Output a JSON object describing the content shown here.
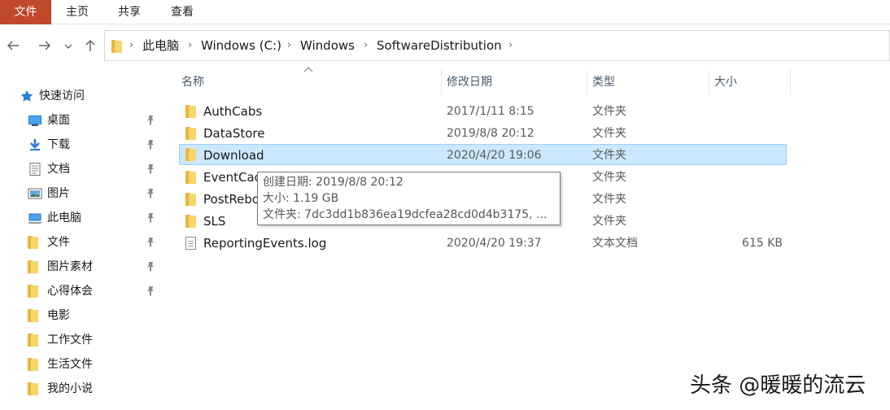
{
  "ribbon": {
    "tabs": [
      {
        "label": "文件",
        "active": true
      },
      {
        "label": "主页"
      },
      {
        "label": "共享"
      },
      {
        "label": "查看"
      }
    ]
  },
  "address": {
    "crumbs": [
      "此电脑",
      "Windows (C:)",
      "Windows",
      "SoftwareDistribution"
    ]
  },
  "sidebar": {
    "quick_access": "快速访问",
    "items": [
      {
        "label": "桌面",
        "pinned": true,
        "icon": "desktop-icon"
      },
      {
        "label": "下载",
        "pinned": true,
        "icon": "download-icon"
      },
      {
        "label": "文档",
        "pinned": true,
        "icon": "document-icon"
      },
      {
        "label": "图片",
        "pinned": true,
        "icon": "picture-icon"
      },
      {
        "label": "此电脑",
        "pinned": true,
        "icon": "computer-icon"
      },
      {
        "label": "文件",
        "pinned": true,
        "icon": "folder-icon"
      },
      {
        "label": "图片素材",
        "pinned": true,
        "icon": "folder-icon"
      },
      {
        "label": "心得体会",
        "pinned": true,
        "icon": "folder-icon"
      },
      {
        "label": "电影",
        "pinned": false,
        "icon": "folder-icon"
      },
      {
        "label": "工作文件",
        "pinned": false,
        "icon": "folder-icon"
      },
      {
        "label": "生活文件",
        "pinned": false,
        "icon": "folder-icon"
      },
      {
        "label": "我的小说",
        "pinned": false,
        "icon": "folder-icon"
      }
    ]
  },
  "columns": {
    "name": "名称",
    "date": "修改日期",
    "type": "类型",
    "size": "大小"
  },
  "files": [
    {
      "name": "AuthCabs",
      "date": "2017/1/11 8:15",
      "type": "文件夹",
      "size": "",
      "kind": "folder"
    },
    {
      "name": "DataStore",
      "date": "2019/8/8 20:12",
      "type": "文件夹",
      "size": "",
      "kind": "folder"
    },
    {
      "name": "Download",
      "date": "2020/4/20 19:06",
      "type": "文件夹",
      "size": "",
      "kind": "folder",
      "selected": true
    },
    {
      "name": "EventCac",
      "date": "",
      "type": "文件夹",
      "size": "",
      "kind": "folder"
    },
    {
      "name": "PostRebo",
      "date": "",
      "type": "文件夹",
      "size": "",
      "kind": "folder"
    },
    {
      "name": "SLS",
      "date": "",
      "type": "文件夹",
      "size": "",
      "kind": "folder"
    },
    {
      "name": "ReportingEvents.log",
      "date": "2020/4/20 19:37",
      "type": "文本文档",
      "size": "615 KB",
      "kind": "doc"
    }
  ],
  "tooltip": {
    "created": "创建日期: 2019/8/8 20:12",
    "size": "大小: 1.19 GB",
    "folders": "文件夹: 7dc3dd1b836ea19dcfea28cd0d4b3175, ..."
  },
  "watermark": "头条 @暖暖的流云",
  "colors": {
    "file_tab": "#c0482b",
    "selection": "#cce8ff",
    "selection_border": "#99d1ff",
    "folder": "#f7d56b"
  }
}
